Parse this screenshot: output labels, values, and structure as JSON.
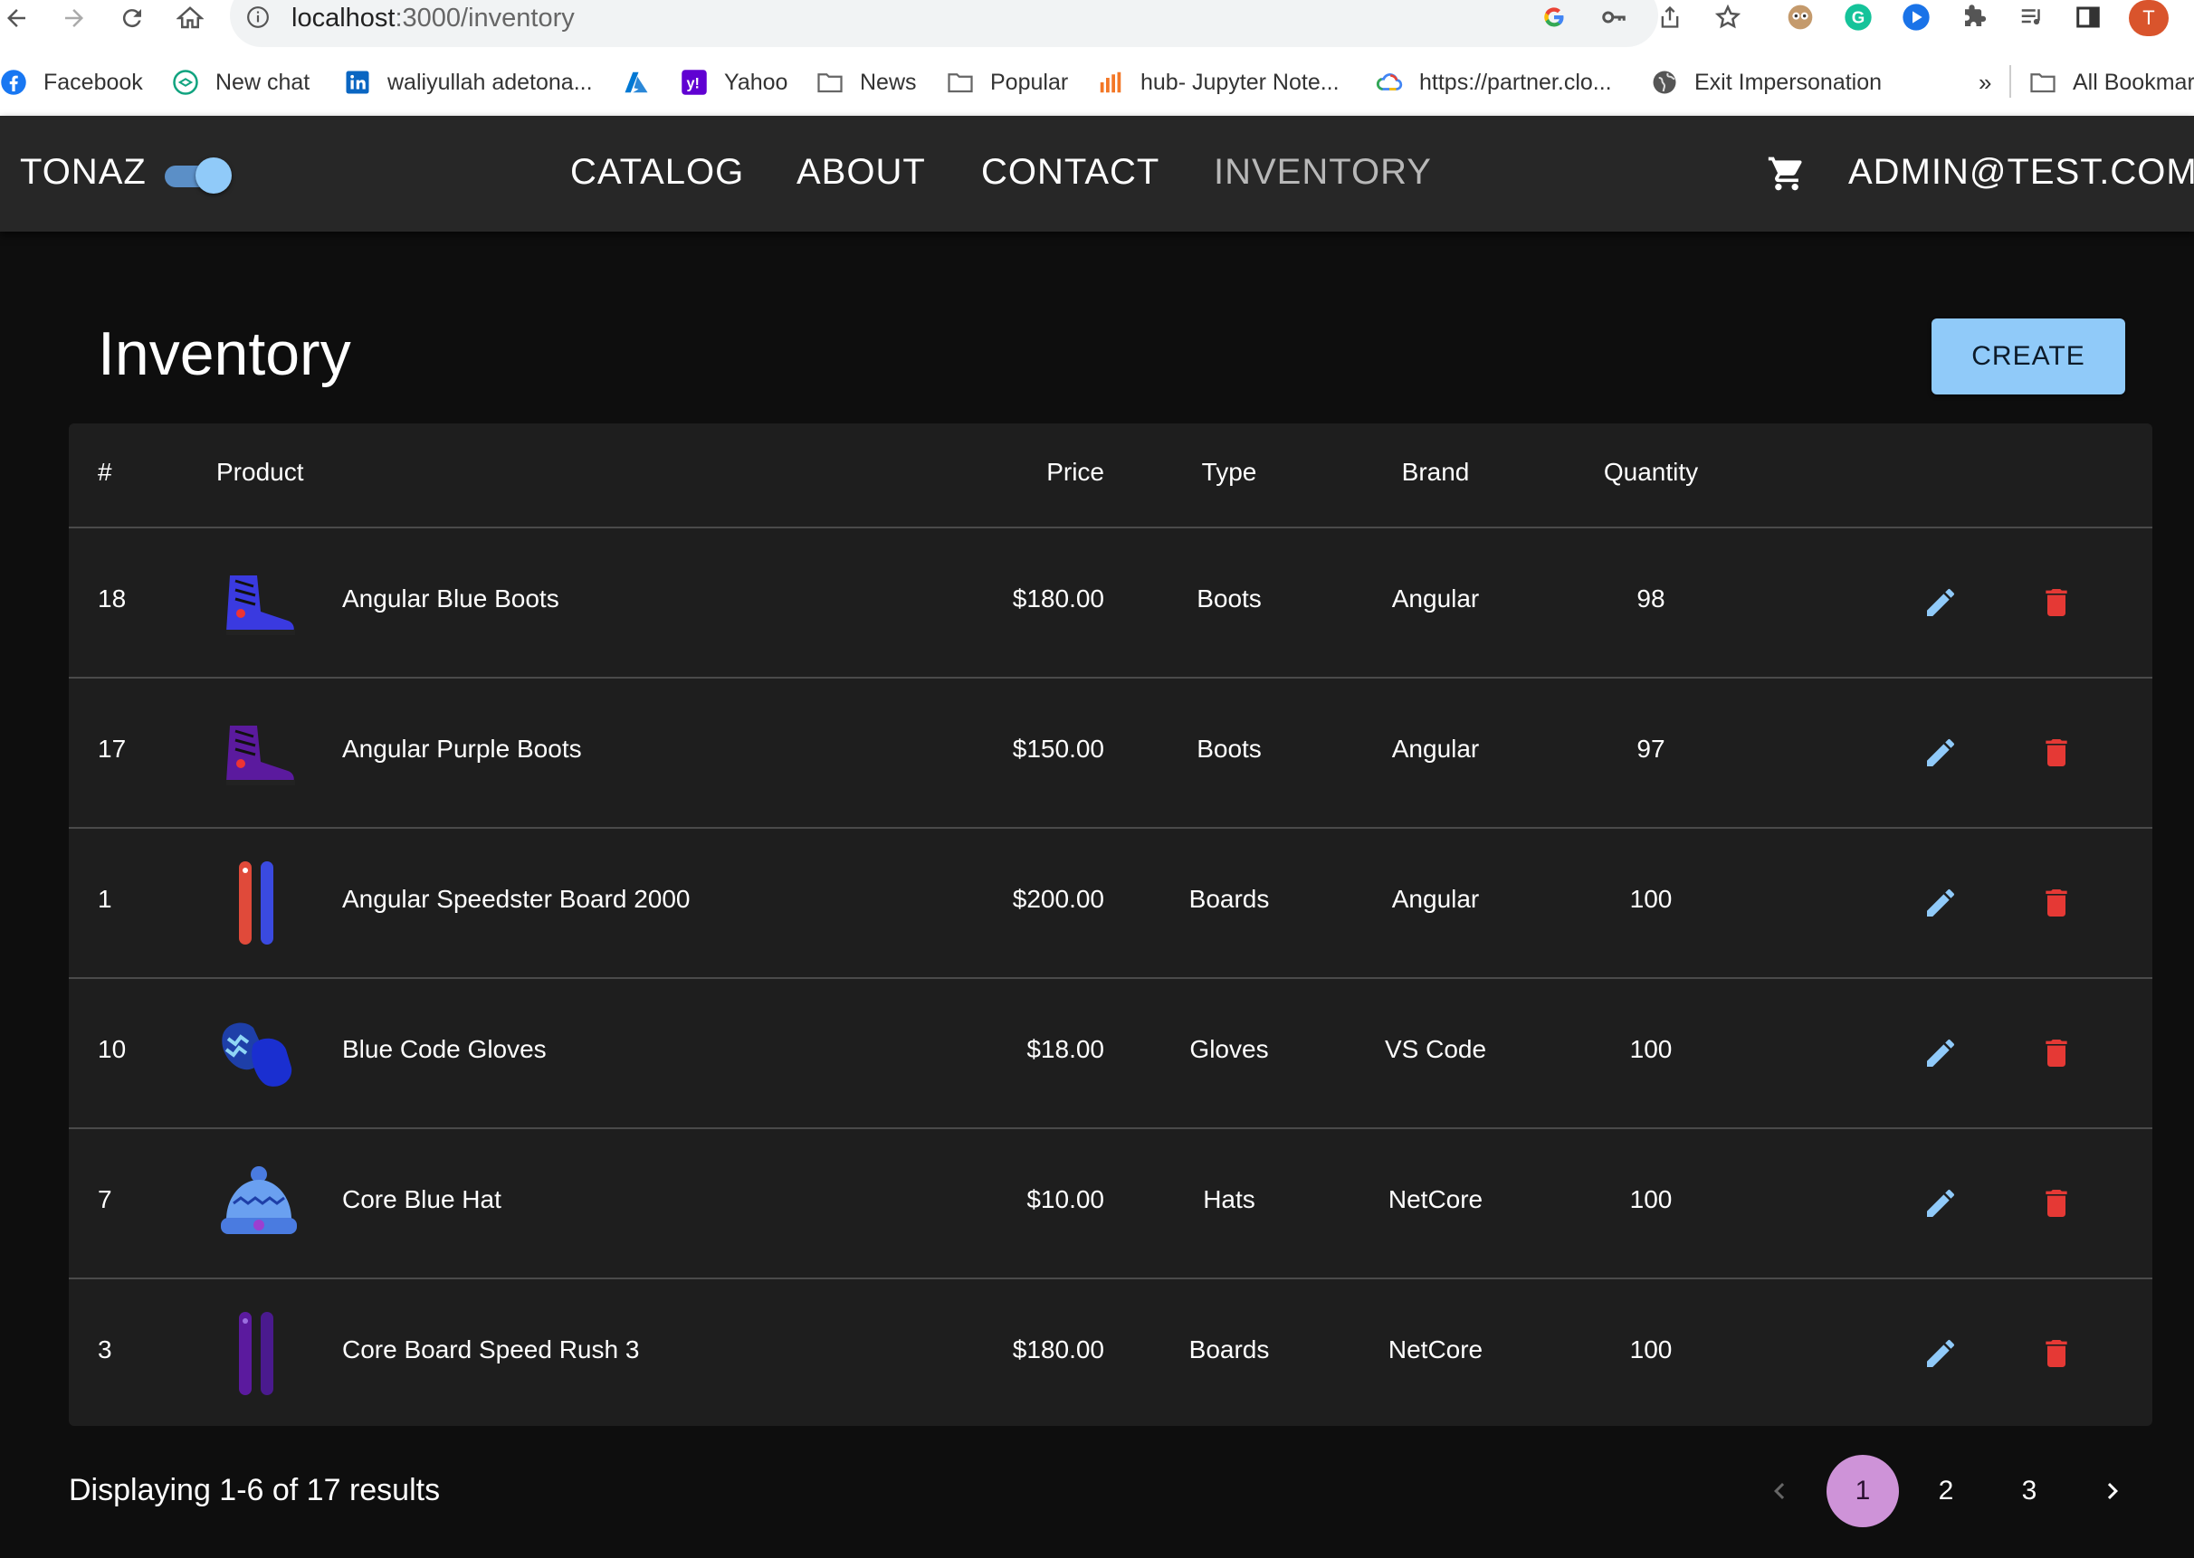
{
  "browser": {
    "url_host": "localhost",
    "url_path": ":3000/inventory",
    "profile_initial": "T",
    "bookmarks": [
      {
        "label": "Facebook",
        "icon": "facebook-icon"
      },
      {
        "label": "New chat",
        "icon": "chatgpt-icon"
      },
      {
        "label": "waliyullah adetona...",
        "icon": "linkedin-icon"
      },
      {
        "label": "",
        "icon": "azure-icon"
      },
      {
        "label": "Yahoo",
        "icon": "yahoo-icon"
      },
      {
        "label": "News",
        "icon": "folder-icon"
      },
      {
        "label": "Popular",
        "icon": "folder-icon"
      },
      {
        "label": "hub- Jupyter Note...",
        "icon": "jupyter-icon"
      },
      {
        "label": "https://partner.clo...",
        "icon": "google-cloud-icon"
      },
      {
        "label": "Exit Impersonation",
        "icon": "globe-icon"
      }
    ],
    "overflow": "»",
    "all_bookmarks": "All Bookmar"
  },
  "appbar": {
    "brand": "TONAZ",
    "nav": [
      "CATALOG",
      "ABOUT",
      "CONTACT",
      "INVENTORY"
    ],
    "active_nav": "INVENTORY",
    "user": "ADMIN@TEST.COM"
  },
  "page": {
    "title": "Inventory",
    "create_label": "CREATE"
  },
  "table": {
    "headers": {
      "id": "#",
      "product": "Product",
      "price": "Price",
      "type": "Type",
      "brand": "Brand",
      "quantity": "Quantity"
    },
    "rows": [
      {
        "id": "18",
        "name": "Angular Blue Boots",
        "price": "$180.00",
        "type": "Boots",
        "brand": "Angular",
        "quantity": "98",
        "image": "boot-blue"
      },
      {
        "id": "17",
        "name": "Angular Purple Boots",
        "price": "$150.00",
        "type": "Boots",
        "brand": "Angular",
        "quantity": "97",
        "image": "boot-purple"
      },
      {
        "id": "1",
        "name": "Angular Speedster Board 2000",
        "price": "$200.00",
        "type": "Boards",
        "brand": "Angular",
        "quantity": "100",
        "image": "board-red-blue"
      },
      {
        "id": "10",
        "name": "Blue Code Gloves",
        "price": "$18.00",
        "type": "Gloves",
        "brand": "VS Code",
        "quantity": "100",
        "image": "gloves-blue"
      },
      {
        "id": "7",
        "name": "Core Blue Hat",
        "price": "$10.00",
        "type": "Hats",
        "brand": "NetCore",
        "quantity": "100",
        "image": "hat-blue"
      },
      {
        "id": "3",
        "name": "Core Board Speed Rush 3",
        "price": "$180.00",
        "type": "Boards",
        "brand": "NetCore",
        "quantity": "100",
        "image": "board-purple"
      }
    ]
  },
  "pagination": {
    "summary": "Displaying 1-6 of 17 results",
    "pages": [
      "1",
      "2",
      "3"
    ],
    "current": "1"
  },
  "colors": {
    "accent": "#90caf9",
    "delete": "#e53935",
    "page_current": "#ce93d8"
  }
}
